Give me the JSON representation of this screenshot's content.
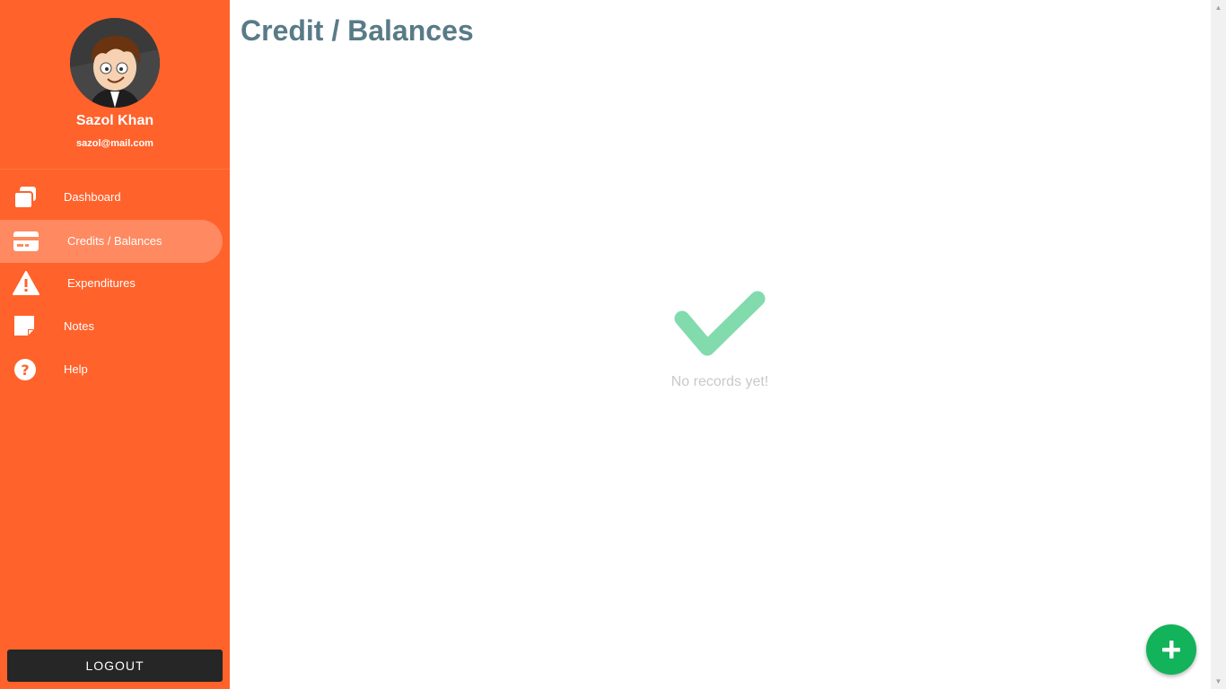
{
  "user": {
    "name": "Sazol Khan",
    "email": "sazol@mail.com"
  },
  "nav": {
    "dashboard": "Dashboard",
    "credits": "Credits / Balances",
    "expenditures": "Expenditures",
    "notes": "Notes",
    "help": "Help"
  },
  "logout_label": "LOGOUT",
  "page": {
    "title": "Credit / Balances"
  },
  "empty_state": {
    "message": "No records yet!"
  },
  "icons": {
    "dashboard": "copy-icon",
    "credits": "credit-card-icon",
    "expenditures": "warning-icon",
    "notes": "note-icon",
    "help": "question-circle-icon",
    "empty": "checkmark-icon",
    "fab": "plus-icon"
  },
  "colors": {
    "sidebar": "#ff622b",
    "title": "#587b87",
    "check": "#82dbad",
    "fab": "#12b35a",
    "logout": "#262626"
  }
}
